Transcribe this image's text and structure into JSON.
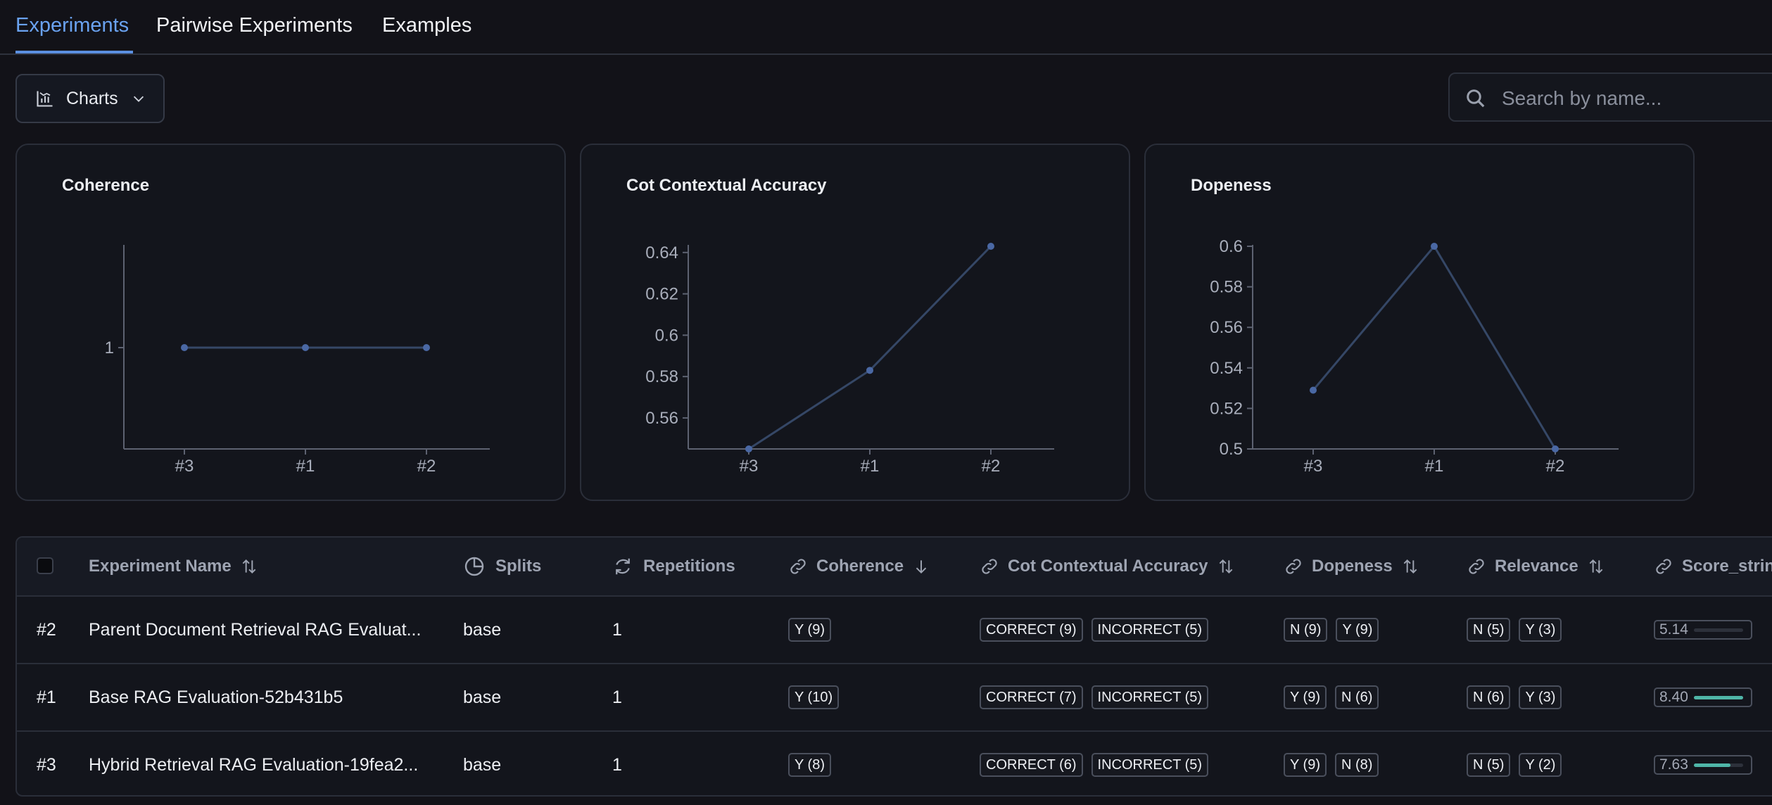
{
  "tabs": [
    {
      "label": "Experiments",
      "active": true
    },
    {
      "label": "Pairwise Experiments",
      "active": false
    },
    {
      "label": "Examples",
      "active": false
    }
  ],
  "toolbar": {
    "charts_label": "Charts",
    "charts_icon": "chart-bars-icon",
    "search_placeholder": "Search by name..."
  },
  "colors": {
    "accent": "#6aa2f0",
    "line": "#354766",
    "point": "#4a68a4",
    "score_fill": "#4fb6a8"
  },
  "chart_data": [
    {
      "type": "line",
      "title": "Coherence",
      "categories": [
        "#3",
        "#1",
        "#2"
      ],
      "values": [
        1,
        1,
        1
      ],
      "yticks": [
        "1"
      ],
      "ylim": [
        0,
        2
      ]
    },
    {
      "type": "line",
      "title": "Cot Contextual Accuracy",
      "categories": [
        "#3",
        "#1",
        "#2"
      ],
      "values": [
        0.545,
        0.583,
        0.643
      ],
      "yticks": [
        "0.64",
        "0.62",
        "0.6",
        "0.58",
        "0.56"
      ],
      "ylim": [
        0.545,
        0.643
      ]
    },
    {
      "type": "line",
      "title": "Dopeness",
      "categories": [
        "#3",
        "#1",
        "#2"
      ],
      "values": [
        0.529,
        0.6,
        0.5
      ],
      "yticks": [
        "0.6",
        "0.58",
        "0.56",
        "0.54",
        "0.52",
        "0.5"
      ],
      "ylim": [
        0.5,
        0.6
      ]
    }
  ],
  "table": {
    "columns": [
      {
        "label": "Experiment Name",
        "icon": "sort-icon"
      },
      {
        "label": "Splits",
        "icon": "pie-chart-icon"
      },
      {
        "label": "Repetitions",
        "icon": "repeat-icon"
      },
      {
        "label": "Coherence",
        "icon": "sort-desc-icon"
      },
      {
        "label": "Cot Contextual Accuracy",
        "icon": "sort-icon"
      },
      {
        "label": "Dopeness",
        "icon": "sort-icon"
      },
      {
        "label": "Relevance",
        "icon": "sort-icon"
      },
      {
        "label": "Score_strin"
      }
    ],
    "rows": [
      {
        "id": "#2",
        "name": "Parent Document Retrieval RAG Evaluat...",
        "splits": "base",
        "repetitions": "1",
        "coherence": [
          "Y (9)"
        ],
        "cot": [
          "CORRECT (9)",
          "INCORRECT (5)"
        ],
        "dopeness": [
          "N (9)",
          "Y (9)"
        ],
        "relevance": [
          "N (5)",
          "Y (3)"
        ],
        "score": "5.14",
        "score_level": 0.0
      },
      {
        "id": "#1",
        "name": "Base RAG Evaluation-52b431b5",
        "splits": "base",
        "repetitions": "1",
        "coherence": [
          "Y (10)"
        ],
        "cot": [
          "CORRECT (7)",
          "INCORRECT (5)"
        ],
        "dopeness": [
          "Y (9)",
          "N (6)"
        ],
        "relevance": [
          "N (6)",
          "Y (3)"
        ],
        "score": "8.40",
        "score_level": 1.0
      },
      {
        "id": "#3",
        "name": "Hybrid Retrieval RAG Evaluation-19fea2...",
        "splits": "base",
        "repetitions": "1",
        "coherence": [
          "Y (8)"
        ],
        "cot": [
          "CORRECT (6)",
          "INCORRECT (5)"
        ],
        "dopeness": [
          "Y (9)",
          "N (8)"
        ],
        "relevance": [
          "N (5)",
          "Y (2)"
        ],
        "score": "7.63",
        "score_level": 0.75
      }
    ]
  }
}
